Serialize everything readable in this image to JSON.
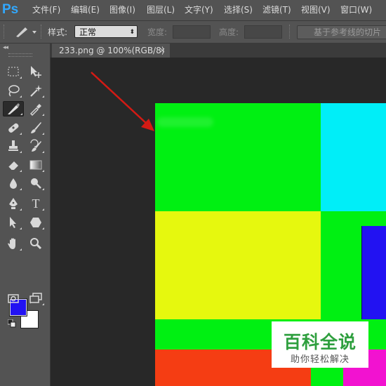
{
  "app": {
    "logo": "Ps",
    "menu": [
      {
        "label": "文件(F)"
      },
      {
        "label": "编辑(E)"
      },
      {
        "label": "图像(I)"
      },
      {
        "label": "图层(L)"
      },
      {
        "label": "文字(Y)"
      },
      {
        "label": "选择(S)"
      },
      {
        "label": "滤镜(T)"
      },
      {
        "label": "视图(V)"
      },
      {
        "label": "窗口(W)"
      }
    ]
  },
  "options_bar": {
    "style_label": "样式:",
    "style_value": "正常",
    "width_label": "宽度:",
    "height_label": "高度:",
    "guides_button": "基于参考线的切片"
  },
  "tools": {
    "active_tool": "slice-tool",
    "text_tool_glyph": "T",
    "foreground_color": "#2212f2",
    "background_color": "#ffffff"
  },
  "document": {
    "tab_title": "233.png @ 100%(RGB/8)",
    "close_glyph": "×"
  },
  "canvas": {
    "colors": {
      "green": "#00f012",
      "cyan": "#00eef8",
      "yellow": "#e6f80e",
      "blue": "#2212f2",
      "red": "#f53d13",
      "magenta": "#f212d0",
      "annotation_arrow": "#d41a14"
    }
  },
  "watermark": {
    "title": "百科全说",
    "subtitle": "助你轻松解决"
  }
}
